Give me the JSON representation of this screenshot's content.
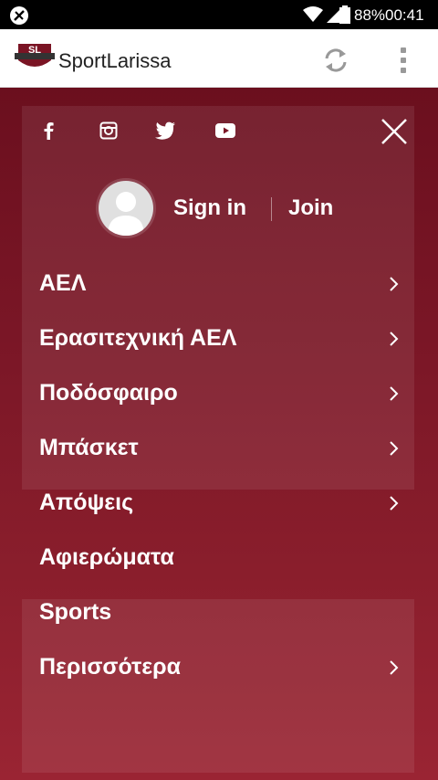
{
  "status_bar": {
    "battery_percent": "88%",
    "time": "00:41",
    "icons": [
      "no-sim-icon",
      "wifi-icon",
      "signal-icon",
      "battery-icon"
    ]
  },
  "app_bar": {
    "logo_text": "SL",
    "title": "SportLarissa",
    "icons": [
      "refresh-icon",
      "overflow-menu-icon"
    ]
  },
  "drawer": {
    "social_icons": [
      "facebook-icon",
      "instagram-icon",
      "twitter-icon",
      "youtube-icon"
    ],
    "close_icon": "close-icon",
    "sign_in": "Sign in",
    "join": "Join",
    "menu": [
      {
        "label": "ΑΕΛ",
        "has_submenu": true
      },
      {
        "label": "Ερασιτεχνική ΑΕΛ",
        "has_submenu": true
      },
      {
        "label": "Ποδόσφαιρο",
        "has_submenu": true
      },
      {
        "label": "Μπάσκετ",
        "has_submenu": true
      },
      {
        "label": "Απόψεις",
        "has_submenu": true
      },
      {
        "label": "Αφιερώματα",
        "has_submenu": false
      },
      {
        "label": "Sports",
        "has_submenu": false
      },
      {
        "label": "Περισσότερα",
        "has_submenu": true
      }
    ],
    "colors": {
      "top": "#6b0f1e",
      "bottom": "#9a2433"
    }
  }
}
